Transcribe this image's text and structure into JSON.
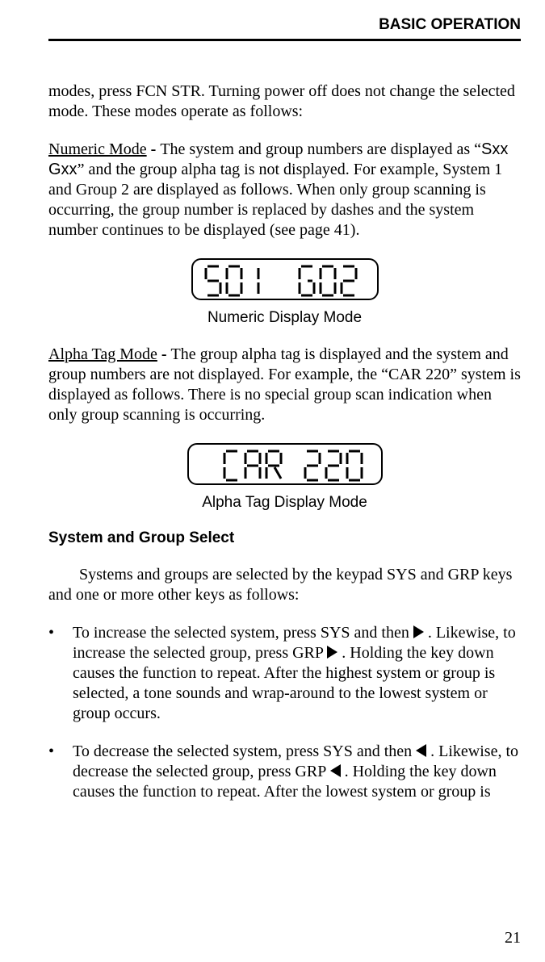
{
  "header": {
    "title": "BASIC OPERATION"
  },
  "paragraphs": {
    "p1": "modes, press FCN STR. Turning power off does not change the selected mode. These modes operate as follows:",
    "p2_mode_label": "Numeric Mode",
    "p2_sep": " - ",
    "p2_a": "The system and group numbers are displayed as “",
    "p2_code": "Sxx Gxx",
    "p2_b": "” and the group alpha tag is not displayed. For example, System 1 and Group 2 are displayed as follows. When only group scanning is occurring, the group number is replaced by dashes and the system number continues to be displayed (see page 41).",
    "fig1_caption": "Numeric Display Mode",
    "p3_mode_label": "Alpha Tag Mode",
    "p3_sep": " - ",
    "p3_body": "The group alpha tag is displayed and the system and group numbers are not displayed. For example, the “CAR 220” system is displayed as follows. There is no special group scan indication when only group scanning is occurring.",
    "fig2_caption": "Alpha Tag Display Mode",
    "subhead": "System and Group Select",
    "p4": "Systems and groups are selected by the keypad SYS and GRP keys and one or more other keys as follows:",
    "b1_a": "To increase the selected system, press SYS and then ",
    "b1_b": ". Likewise, to increase the selected group, press GRP ",
    "b1_c": ". Holding the key down causes the function to repeat. After the highest system or group is selected, a tone sounds and wrap-around to the lowest system or group occurs.",
    "b2_a": "To decrease the selected system, press SYS and then ",
    "b2_b": ". Likewise, to decrease the selected group, press GRP ",
    "b2_c": ". Holding the key down causes the function to repeat. After the lowest system or group is",
    "page_number": "21"
  },
  "displays": {
    "numeric": "S01  G02",
    "alpha": "CAR 220"
  }
}
